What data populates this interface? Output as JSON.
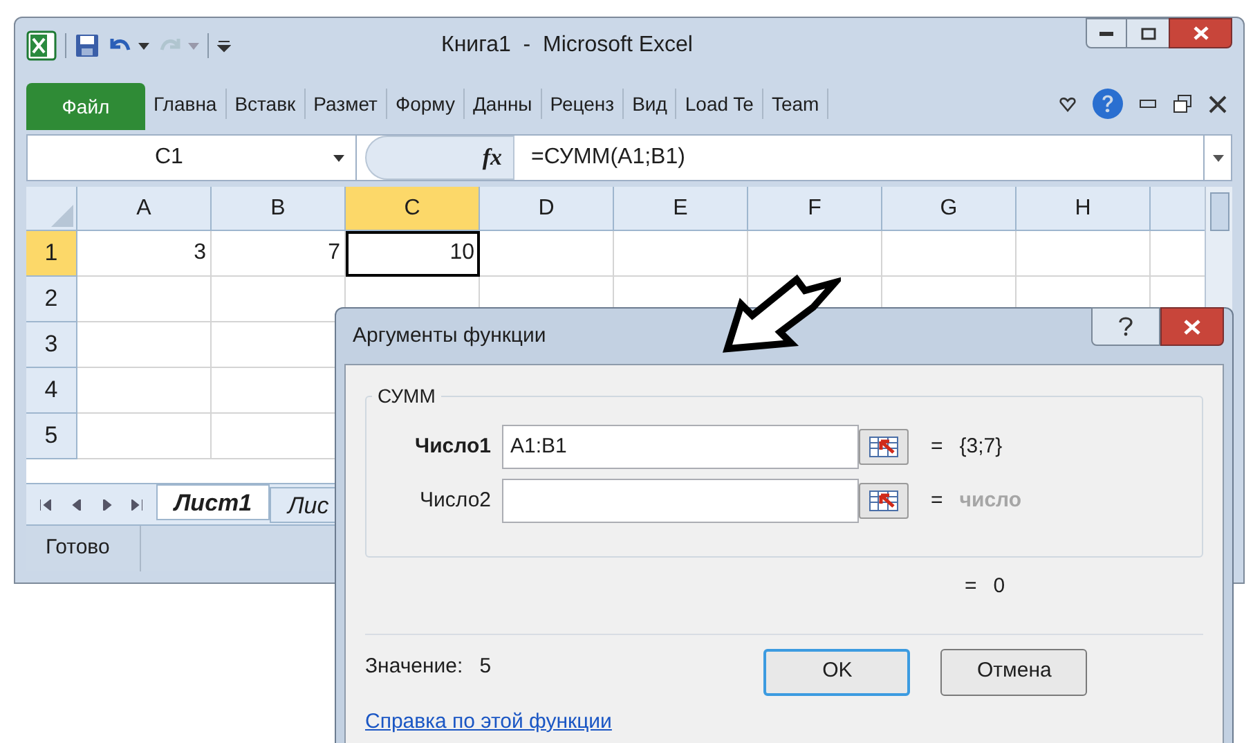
{
  "window": {
    "title": "Книга1  -  Microsoft Excel"
  },
  "quick_access": [
    {
      "kind": "save",
      "disabled": false
    },
    {
      "kind": "undo",
      "disabled": false
    },
    {
      "kind": "redo",
      "disabled": true
    }
  ],
  "ribbon": {
    "file_tab": "Файл",
    "tabs": [
      {
        "label": "Главна"
      },
      {
        "label": "Вставк"
      },
      {
        "label": "Размет"
      },
      {
        "label": "Форму"
      },
      {
        "label": "Данны"
      },
      {
        "label": "Реценз"
      },
      {
        "label": "Вид"
      },
      {
        "label": "Load Te"
      },
      {
        "label": "Team"
      }
    ]
  },
  "formula_bar": {
    "name_box": "C1",
    "function_symbol": "fx",
    "formula": "=СУММ(A1;B1)"
  },
  "sheet": {
    "columns": [
      {
        "label": "A",
        "selected": false
      },
      {
        "label": "B",
        "selected": false
      },
      {
        "label": "C",
        "selected": true
      },
      {
        "label": "D",
        "selected": false
      },
      {
        "label": "E",
        "selected": false
      },
      {
        "label": "F",
        "selected": false
      },
      {
        "label": "G",
        "selected": false
      },
      {
        "label": "H",
        "selected": false
      }
    ],
    "rows": [
      {
        "label": "1",
        "selected": true,
        "cells": [
          {
            "value": "3",
            "selected": false
          },
          {
            "value": "7",
            "selected": false
          },
          {
            "value": "10",
            "selected": true
          }
        ]
      },
      {
        "label": "2",
        "selected": false
      },
      {
        "label": "3",
        "selected": false
      },
      {
        "label": "4",
        "selected": false
      },
      {
        "label": "5",
        "selected": false
      }
    ]
  },
  "sheet_tabs": [
    {
      "label": "Лист1",
      "selected": true
    },
    {
      "label": "Лис",
      "selected": false
    }
  ],
  "status_bar": {
    "text": "Готово"
  },
  "dialog": {
    "title": "Аргументы функции",
    "function_name": "СУММ",
    "arguments": [
      {
        "label": "Число1",
        "required": true,
        "value": "A1:B1",
        "equals": "=",
        "result": "{3;7}",
        "muted": false
      },
      {
        "label": "Число2",
        "required": false,
        "equals": "=",
        "result": "число",
        "muted": true
      }
    ],
    "formula_result": {
      "equals": "=",
      "value": "0"
    },
    "value_label": "Значение:",
    "value": "5",
    "buttons": [
      {
        "label": "OK",
        "default": true
      },
      {
        "label": "Отмена",
        "default": false
      }
    ],
    "help_link": "Справка по этой функции"
  }
}
